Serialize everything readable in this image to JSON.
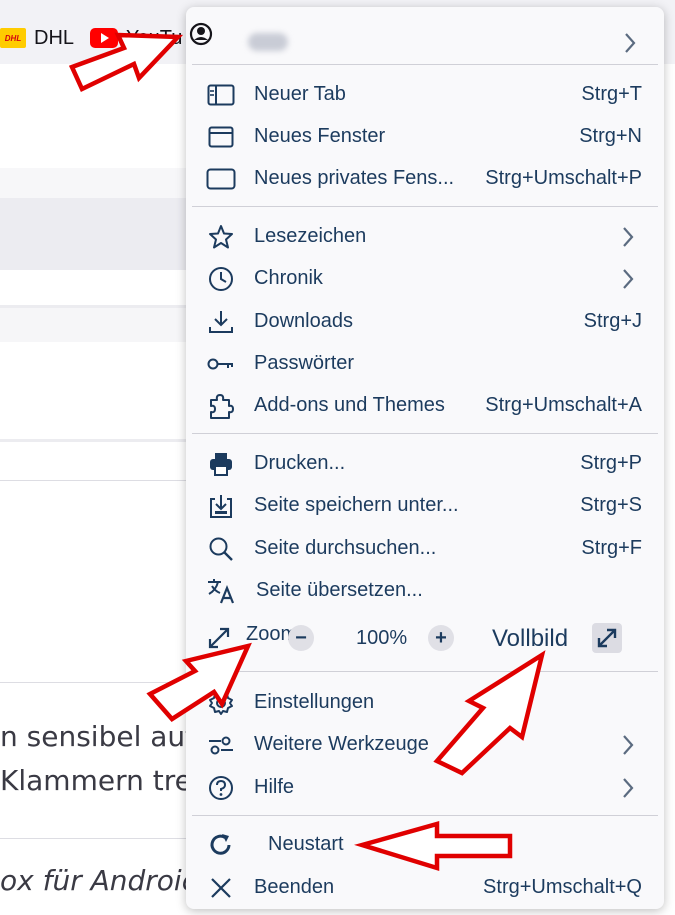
{
  "bookmarks": [
    {
      "label": "DHL",
      "icon": "dhl-icon"
    },
    {
      "label": "YouTu",
      "icon": "youtube-icon"
    }
  ],
  "background_text": {
    "line1": "n sensibel auf",
    "line2": "Klammern tret",
    "line3": "ox für Androic"
  },
  "menu": {
    "account_name": "(blurred)",
    "items": [
      {
        "label": "Neuer Tab",
        "shortcut": "Strg+T",
        "icon": "new-tab-icon"
      },
      {
        "label": "Neues Fenster",
        "shortcut": "Strg+N",
        "icon": "new-window-icon"
      },
      {
        "label": "Neues privates Fens...",
        "shortcut": "Strg+Umschalt+P",
        "icon": "private-window-icon"
      },
      {
        "label": "Lesezeichen",
        "shortcut": "",
        "icon": "star-icon",
        "submenu": true
      },
      {
        "label": "Chronik",
        "shortcut": "",
        "icon": "clock-icon",
        "submenu": true
      },
      {
        "label": "Downloads",
        "shortcut": "Strg+J",
        "icon": "download-icon"
      },
      {
        "label": "Passwörter",
        "shortcut": "",
        "icon": "key-icon"
      },
      {
        "label": "Add-ons und Themes",
        "shortcut": "Strg+Umschalt+A",
        "icon": "puzzle-icon"
      },
      {
        "label": "Drucken...",
        "shortcut": "Strg+P",
        "icon": "print-icon"
      },
      {
        "label": "Seite speichern unter...",
        "shortcut": "Strg+S",
        "icon": "save-icon"
      },
      {
        "label": "Seite durchsuchen...",
        "shortcut": "Strg+F",
        "icon": "search-icon"
      },
      {
        "label": "Seite übersetzen...",
        "shortcut": "",
        "icon": "translate-icon"
      },
      {
        "label": "Einstellungen",
        "shortcut": "",
        "icon": "gear-icon"
      },
      {
        "label": "Weitere Werkzeuge",
        "shortcut": "",
        "icon": "tools-icon",
        "submenu": true
      },
      {
        "label": "Hilfe",
        "shortcut": "",
        "icon": "help-icon",
        "submenu": true
      },
      {
        "label": "Neustart",
        "shortcut": "",
        "icon": "restart-icon"
      },
      {
        "label": "Beenden",
        "shortcut": "Strg+Umschalt+Q",
        "icon": "close-icon"
      }
    ],
    "zoom": {
      "label": "Zoom",
      "minus": "−",
      "value": "100%",
      "plus": "+",
      "fullscreen_label": "Vollbild"
    }
  },
  "colors": {
    "menu_bg": "#f9f9fb",
    "text": "#1c3b5e",
    "annotation_arrow": "#e00000",
    "separator": "#d0d0d7"
  }
}
